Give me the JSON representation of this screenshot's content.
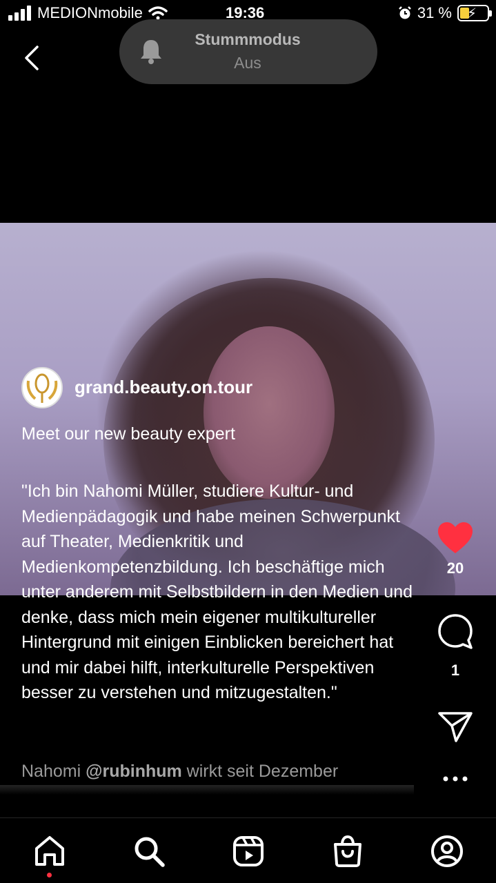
{
  "status_bar": {
    "carrier": "MEDIONmobile",
    "time": "19:36",
    "battery": "31 %"
  },
  "toast": {
    "title": "Stummmodus",
    "subtitle": "Aus"
  },
  "post": {
    "username": "grand.beauty.on.tour",
    "tagline": "Meet our new beauty expert",
    "quote": "\"Ich bin Nahomi Müller, studiere Kultur- und Medienpädagogik und habe meinen Schwerpunkt auf Theater, Medienkritik und Medienkompetenzbildung. Ich beschäftige mich unter anderem mit Selbstbildern in den Medien und denke, dass mich mein eigener multikultureller Hintergrund mit einigen Einblicken bereichert hat und mir dabei hilft, interkulturelle Perspektiven besser zu verstehen und mitzugestalten.\"",
    "more_prefix": "Nahomi ",
    "more_mention": "@rubinhum",
    "more_suffix": " wirkt seit Dezember"
  },
  "actions": {
    "likes": "20",
    "comments": "1",
    "like_color": "#ff3040"
  },
  "icons": [
    "back-chevron-icon",
    "bell-icon",
    "heart-icon",
    "comment-icon",
    "send-icon",
    "more-icon",
    "home-icon",
    "search-icon",
    "reels-icon",
    "shop-icon",
    "profile-icon"
  ]
}
